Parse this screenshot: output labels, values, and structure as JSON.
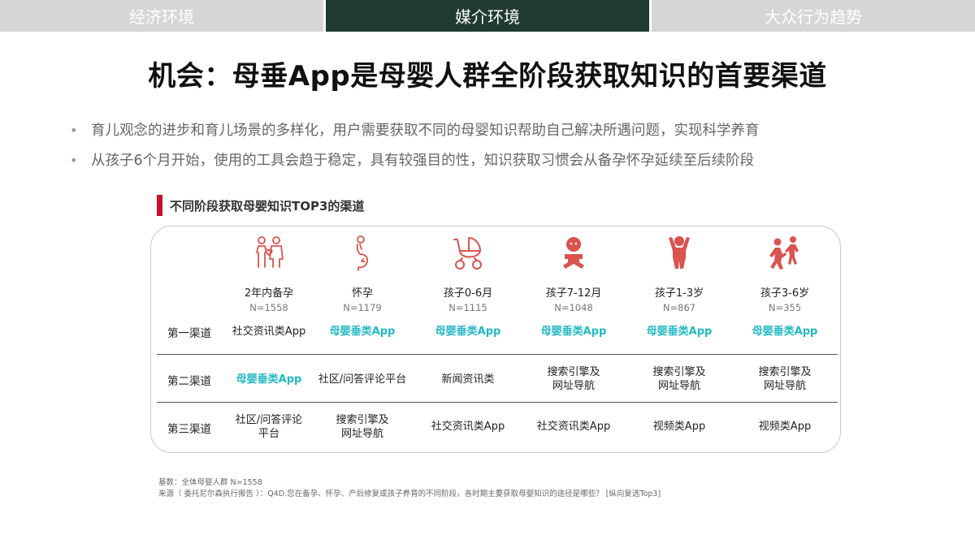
{
  "tabs": [
    {
      "label": "经济环境",
      "active": false
    },
    {
      "label": "媒介环境",
      "active": true
    },
    {
      "label": "大众行为趋势",
      "active": false
    }
  ],
  "title": "机会：母垂App是母婴人群全阶段获取知识的首要渠道",
  "bullets": [
    "育儿观念的进步和育儿场景的多样化，用户需要获取不同的母婴知识帮助自己解决所遇问题，实现科学养育",
    "从孩子6个月开始，使用的工具会趋于稳定，具有较强目的性，知识获取习惯会从备孕怀孕延续至后续阶段"
  ],
  "section_title": "不同阶段获取母婴知识TOP3的渠道",
  "stages": [
    {
      "icon": "couple-icon",
      "name": "2年内备孕",
      "n": "N=1558"
    },
    {
      "icon": "pregnant-woman-icon",
      "name": "怀孕",
      "n": "N=1179"
    },
    {
      "icon": "stroller-icon",
      "name": "孩子0-6月",
      "n": "N=1115"
    },
    {
      "icon": "baby-icon",
      "name": "孩子7-12月",
      "n": "N=1048"
    },
    {
      "icon": "toddler-icon",
      "name": "孩子1-3岁",
      "n": "N=867"
    },
    {
      "icon": "running-child-icon",
      "name": "孩子3-6岁",
      "n": "N=355"
    }
  ],
  "rows": [
    {
      "label": "第一渠道",
      "cells": [
        {
          "lines": [
            "社交资讯类App"
          ],
          "hl": false
        },
        {
          "lines": [
            "母婴垂类App"
          ],
          "hl": true
        },
        {
          "lines": [
            "母婴垂类App"
          ],
          "hl": true
        },
        {
          "lines": [
            "母婴垂类App"
          ],
          "hl": true
        },
        {
          "lines": [
            "母婴垂类App"
          ],
          "hl": true
        },
        {
          "lines": [
            "母婴垂类App"
          ],
          "hl": true
        }
      ]
    },
    {
      "label": "第二渠道",
      "cells": [
        {
          "lines": [
            "母婴垂类App"
          ],
          "hl": true
        },
        {
          "lines": [
            "社区/问答评论平台"
          ],
          "hl": false
        },
        {
          "lines": [
            "新闻资讯类"
          ],
          "hl": false
        },
        {
          "lines": [
            "搜索引擎及",
            "网址导航"
          ],
          "hl": false
        },
        {
          "lines": [
            "搜索引擎及",
            "网址导航"
          ],
          "hl": false
        },
        {
          "lines": [
            "搜索引擎及",
            "网址导航"
          ],
          "hl": false
        }
      ]
    },
    {
      "label": "第三渠道",
      "cells": [
        {
          "lines": [
            "社区/问答评论",
            "平台"
          ],
          "hl": false
        },
        {
          "lines": [
            "搜索引擎及",
            "网址导航"
          ],
          "hl": false
        },
        {
          "lines": [
            "社交资讯类App"
          ],
          "hl": false
        },
        {
          "lines": [
            "社交资讯类App"
          ],
          "hl": false
        },
        {
          "lines": [
            "视频类App"
          ],
          "hl": false
        },
        {
          "lines": [
            "视频类App"
          ],
          "hl": false
        }
      ]
    }
  ],
  "footnotes": [
    "基数：全体母婴人群 N=1558",
    "来源（ 委托尼尔森执行报告 ）：Q4D.您在备孕、怀孕、产后修复或孩子养育的不同阶段，各时期主要获取母婴知识的途径是哪些？ [纵向复选Top3]"
  ],
  "colors": {
    "accent": "#c8102e",
    "highlight": "#25b8c6",
    "icon": "#d9534f",
    "active_tab": "#213b31"
  }
}
